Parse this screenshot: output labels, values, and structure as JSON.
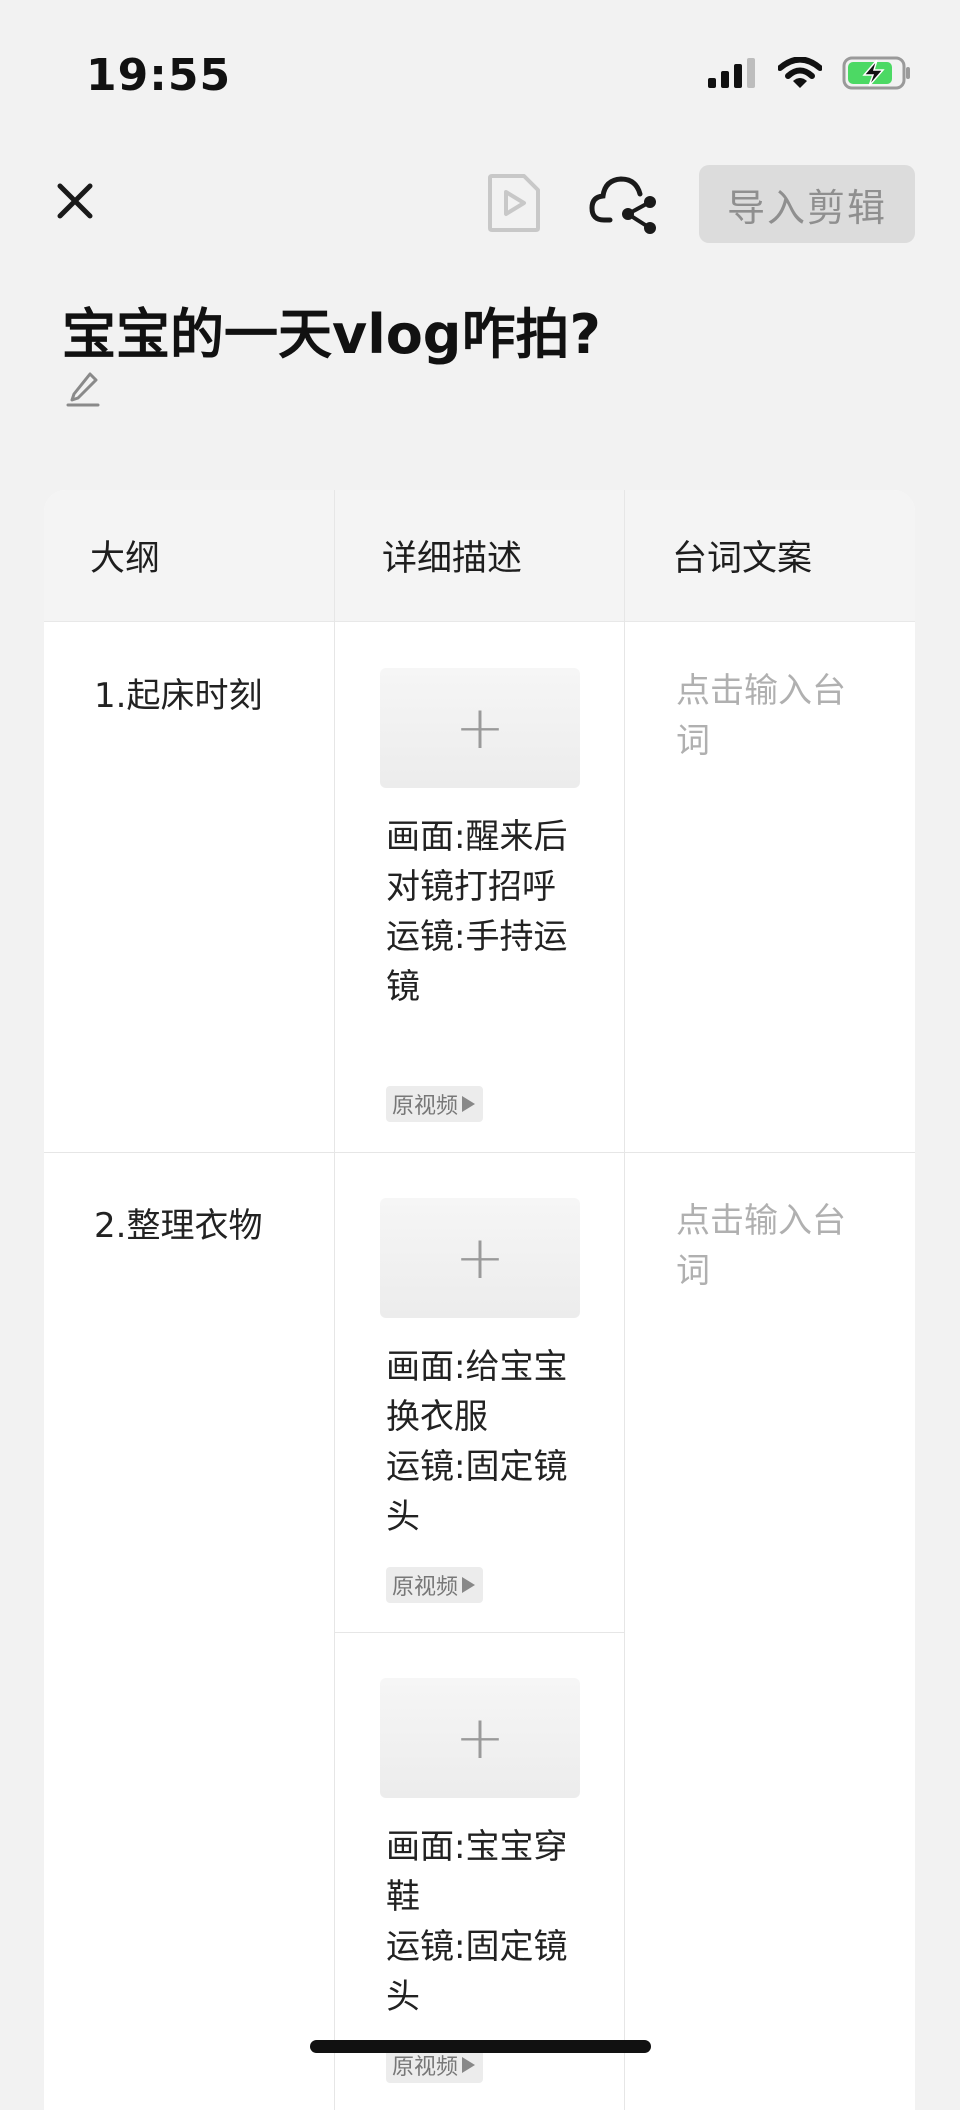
{
  "status_bar": {
    "time": "19:55",
    "icons": [
      "signal-icon",
      "wifi-icon",
      "battery-charging-icon"
    ],
    "battery_color": "#4cd964"
  },
  "toolbar": {
    "close_icon": "close-icon",
    "preview_icon": "video-preview-icon",
    "share_icon": "cloud-share-icon",
    "import_label": "导入剪辑"
  },
  "title": {
    "text": "宝宝的一天vlog咋拍?",
    "edit_icon": "edit-pencil-icon"
  },
  "table": {
    "headers": [
      "大纲",
      "详细描述",
      "台词文案"
    ],
    "rows": [
      {
        "outline": "1.起床时刻",
        "shots": [
          {
            "add_icon": "plus-icon",
            "description": "画面:醒来后对镜打招呼\n运镜:手持运镜",
            "tag": "原视频"
          }
        ],
        "lines_placeholder": "点击输入台词"
      },
      {
        "outline": "2.整理衣物",
        "shots": [
          {
            "add_icon": "plus-icon",
            "description": "画面:给宝宝换衣服\n运镜:固定镜头",
            "tag": "原视频"
          },
          {
            "add_icon": "plus-icon",
            "description": "画面:宝宝穿鞋\n运镜:固定镜头",
            "tag": "原视频"
          }
        ],
        "lines_placeholder": "点击输入台词"
      }
    ]
  }
}
